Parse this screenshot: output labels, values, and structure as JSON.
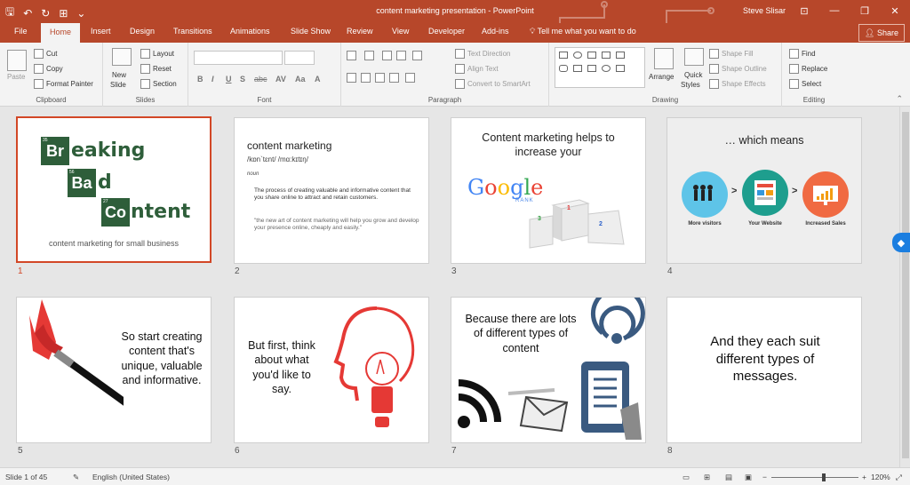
{
  "window": {
    "title": "content marketing presentation - PowerPoint",
    "user": "Steve Slisar",
    "minimize": "—",
    "maximize": "❐",
    "close": "✕",
    "ribbon_display": "⊡"
  },
  "qat": {
    "save": "🖫",
    "undo": "↶",
    "redo": "↻",
    "present": "⊞",
    "customize": "⌄"
  },
  "tabs": [
    "File",
    "Home",
    "Insert",
    "Design",
    "Transitions",
    "Animations",
    "Slide Show",
    "Review",
    "View",
    "Developer",
    "Add-ins"
  ],
  "active_tab": "Home",
  "tell_me": "Tell me what you want to do",
  "share": "Share",
  "ribbon": {
    "clipboard": {
      "label": "Clipboard",
      "paste": "Paste",
      "cut": "Cut",
      "copy": "Copy",
      "format_painter": "Format Painter"
    },
    "slides": {
      "label": "Slides",
      "new_slide_1": "New",
      "new_slide_2": "Slide",
      "layout": "Layout",
      "reset": "Reset",
      "section": "Section"
    },
    "font": {
      "label": "Font",
      "bold": "B",
      "italic": "I",
      "underline": "U",
      "strike": "S",
      "abc": "abc",
      "spacing": "AV",
      "case": "Aa",
      "color": "A"
    },
    "paragraph": {
      "label": "Paragraph",
      "text_direction": "Text Direction",
      "align_text": "Align Text",
      "smartart": "Convert to SmartArt"
    },
    "drawing": {
      "label": "Drawing",
      "arrange": "Arrange",
      "quick_styles_1": "Quick",
      "quick_styles_2": "Styles",
      "shape_fill": "Shape Fill",
      "shape_outline": "Shape Outline",
      "shape_effects": "Shape Effects"
    },
    "editing": {
      "label": "Editing",
      "find": "Find",
      "replace": "Replace",
      "select": "Select"
    }
  },
  "slides": [
    {
      "num": "1",
      "word1_cell": "Br",
      "word1_rest": "eaking",
      "word2_cell": "Ba",
      "word2_rest": "d",
      "word3_cell": "Co",
      "word3_rest": "ntent",
      "cell1_sub": "35",
      "cell2_sub": "56",
      "cell3_sub": "27",
      "subtitle": "content marketing for small business"
    },
    {
      "num": "2",
      "title": "content marketing",
      "pronunciation": "/kɒn`tɛnt/ /mɑ:kɪtɪŋ/",
      "noun": "noun",
      "definition": "The process of creating valuable and informative content  that you share online to attract and retain customers.",
      "quote": "\"the new art of content marketing will help you grow and develop your presence online, cheaply and easily.\""
    },
    {
      "num": "3",
      "title_line1": "Content marketing helps to",
      "title_line2": "increase your",
      "google": [
        "G",
        "o",
        "o",
        "g",
        "l",
        "e"
      ],
      "rank": "RANK",
      "podium": [
        "1",
        "2",
        "3"
      ]
    },
    {
      "num": "4",
      "title": "… which means",
      "labels": [
        "More visitors",
        "Your Website",
        "Increased Sales"
      ],
      "arrow": ">"
    },
    {
      "num": "5",
      "text": "So start creating content that's unique, valuable and informative."
    },
    {
      "num": "6",
      "text": "But first, think about what you'd like to say."
    },
    {
      "num": "7",
      "text": "Because there are lots of different types of content"
    },
    {
      "num": "8",
      "text": "And they each suit different types of messages."
    }
  ],
  "status": {
    "slide_counter": "Slide 1 of 45",
    "language": "English (United States)",
    "zoom_minus": "−",
    "zoom_plus": "+",
    "zoom": "120%"
  },
  "colors": {
    "accent": "#b7472a",
    "selection": "#d24726",
    "bb_green": "#2e5e3a"
  }
}
